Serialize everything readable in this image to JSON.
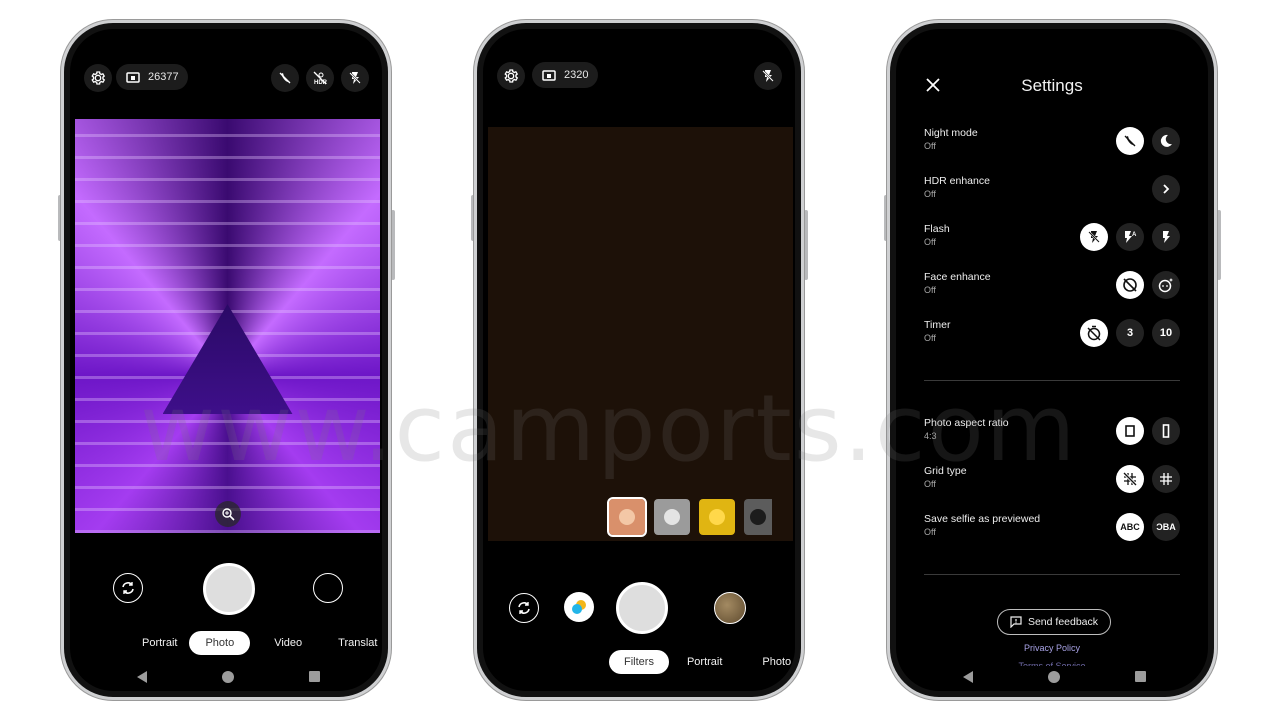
{
  "phones": [
    {
      "name": "camera-photo-mode",
      "photo_count": "26377",
      "top_icons": [
        "settings-icon",
        "photo-count-icon",
        "night-mode-off-icon",
        "hdr-off-icon",
        "flash-off-icon"
      ],
      "controls": [
        "switch-camera-icon",
        "shutter-button",
        "gallery-thumbnail"
      ],
      "modes": [
        "Portrait",
        "Photo",
        "Video",
        "Translat"
      ],
      "active_mode": "Photo"
    },
    {
      "name": "camera-filters-mode",
      "photo_count": "2320",
      "top_icons": [
        "settings-icon",
        "photo-count-icon",
        "flash-off-icon"
      ],
      "filters": [
        {
          "name": "filter-warm",
          "bg": "#d9906b",
          "ball": "#f3c7a6",
          "selected": true
        },
        {
          "name": "filter-mono",
          "bg": "#9b9b9b",
          "ball": "#e4e4e4",
          "selected": false
        },
        {
          "name": "filter-gold",
          "bg": "#e0b512",
          "ball": "#ffd84a",
          "selected": false
        },
        {
          "name": "filter-dark",
          "bg": "#5c5c5c",
          "ball": "#1c1c1c",
          "selected": false
        }
      ],
      "modes": [
        "Filters",
        "Portrait",
        "Photo"
      ],
      "active_mode": "Filters"
    }
  ],
  "settings": {
    "title": "Settings",
    "rows": [
      {
        "label": "Night mode",
        "value": "Off",
        "options": [
          "night-off-icon",
          "night-on-icon"
        ],
        "selected": 0
      },
      {
        "label": "HDR enhance",
        "value": "Off",
        "options": [
          "chevron-right-icon"
        ],
        "selected": -1
      },
      {
        "label": "Flash",
        "value": "Off",
        "options": [
          "flash-off-icon",
          "flash-auto-icon",
          "flash-on-icon"
        ],
        "selected": 0
      },
      {
        "label": "Face enhance",
        "value": "Off",
        "options": [
          "face-enhance-off-icon",
          "face-enhance-on-icon"
        ],
        "selected": 0
      },
      {
        "label": "Timer",
        "value": "Off",
        "options": [
          "timer-off-icon",
          "3",
          "10"
        ],
        "selected": 0
      },
      {
        "label": "Photo aspect ratio",
        "value": "4:3",
        "options": [
          "ratio-4-3-icon",
          "ratio-16-9-icon"
        ],
        "selected": 0
      },
      {
        "label": "Grid type",
        "value": "Off",
        "options": [
          "grid-off-icon",
          "grid-icon"
        ],
        "selected": 0
      },
      {
        "label": "Save selfie as previewed",
        "value": "Off",
        "options": [
          "ABC",
          "ƆBA"
        ],
        "selected": 0
      }
    ],
    "send_feedback": "Send feedback",
    "privacy_policy": "Privacy Policy",
    "terms": "Terms of Service"
  },
  "watermark": "www.camports.com"
}
